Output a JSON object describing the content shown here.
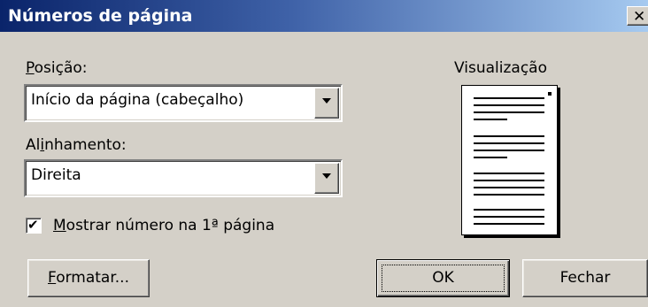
{
  "dialog": {
    "title": "Números de página",
    "close_glyph": "✕"
  },
  "position": {
    "label_before": "",
    "label_mnemonic": "P",
    "label_after": "osição:",
    "value": "Início da página (cabeçalho)"
  },
  "alignment": {
    "label_before": "Al",
    "label_mnemonic": "i",
    "label_after": "nhamento:",
    "value": "Direita"
  },
  "show_first_page": {
    "checked": true,
    "check_glyph": "✔",
    "label_before": "",
    "label_mnemonic": "M",
    "label_after": "ostrar número na 1ª página"
  },
  "preview": {
    "label": "Visualização"
  },
  "buttons": {
    "format_before": "",
    "format_mnemonic": "F",
    "format_after": "ormatar...",
    "ok": "OK",
    "close": "Fechar"
  },
  "colors": {
    "title_gradient_start": "#0a246a",
    "title_gradient_end": "#a6caf0",
    "dialog_face": "#d4d0c8"
  },
  "icons": [
    "close-icon",
    "dropdown-arrow-icon",
    "checkmark-icon",
    "page-preview-icon"
  ]
}
